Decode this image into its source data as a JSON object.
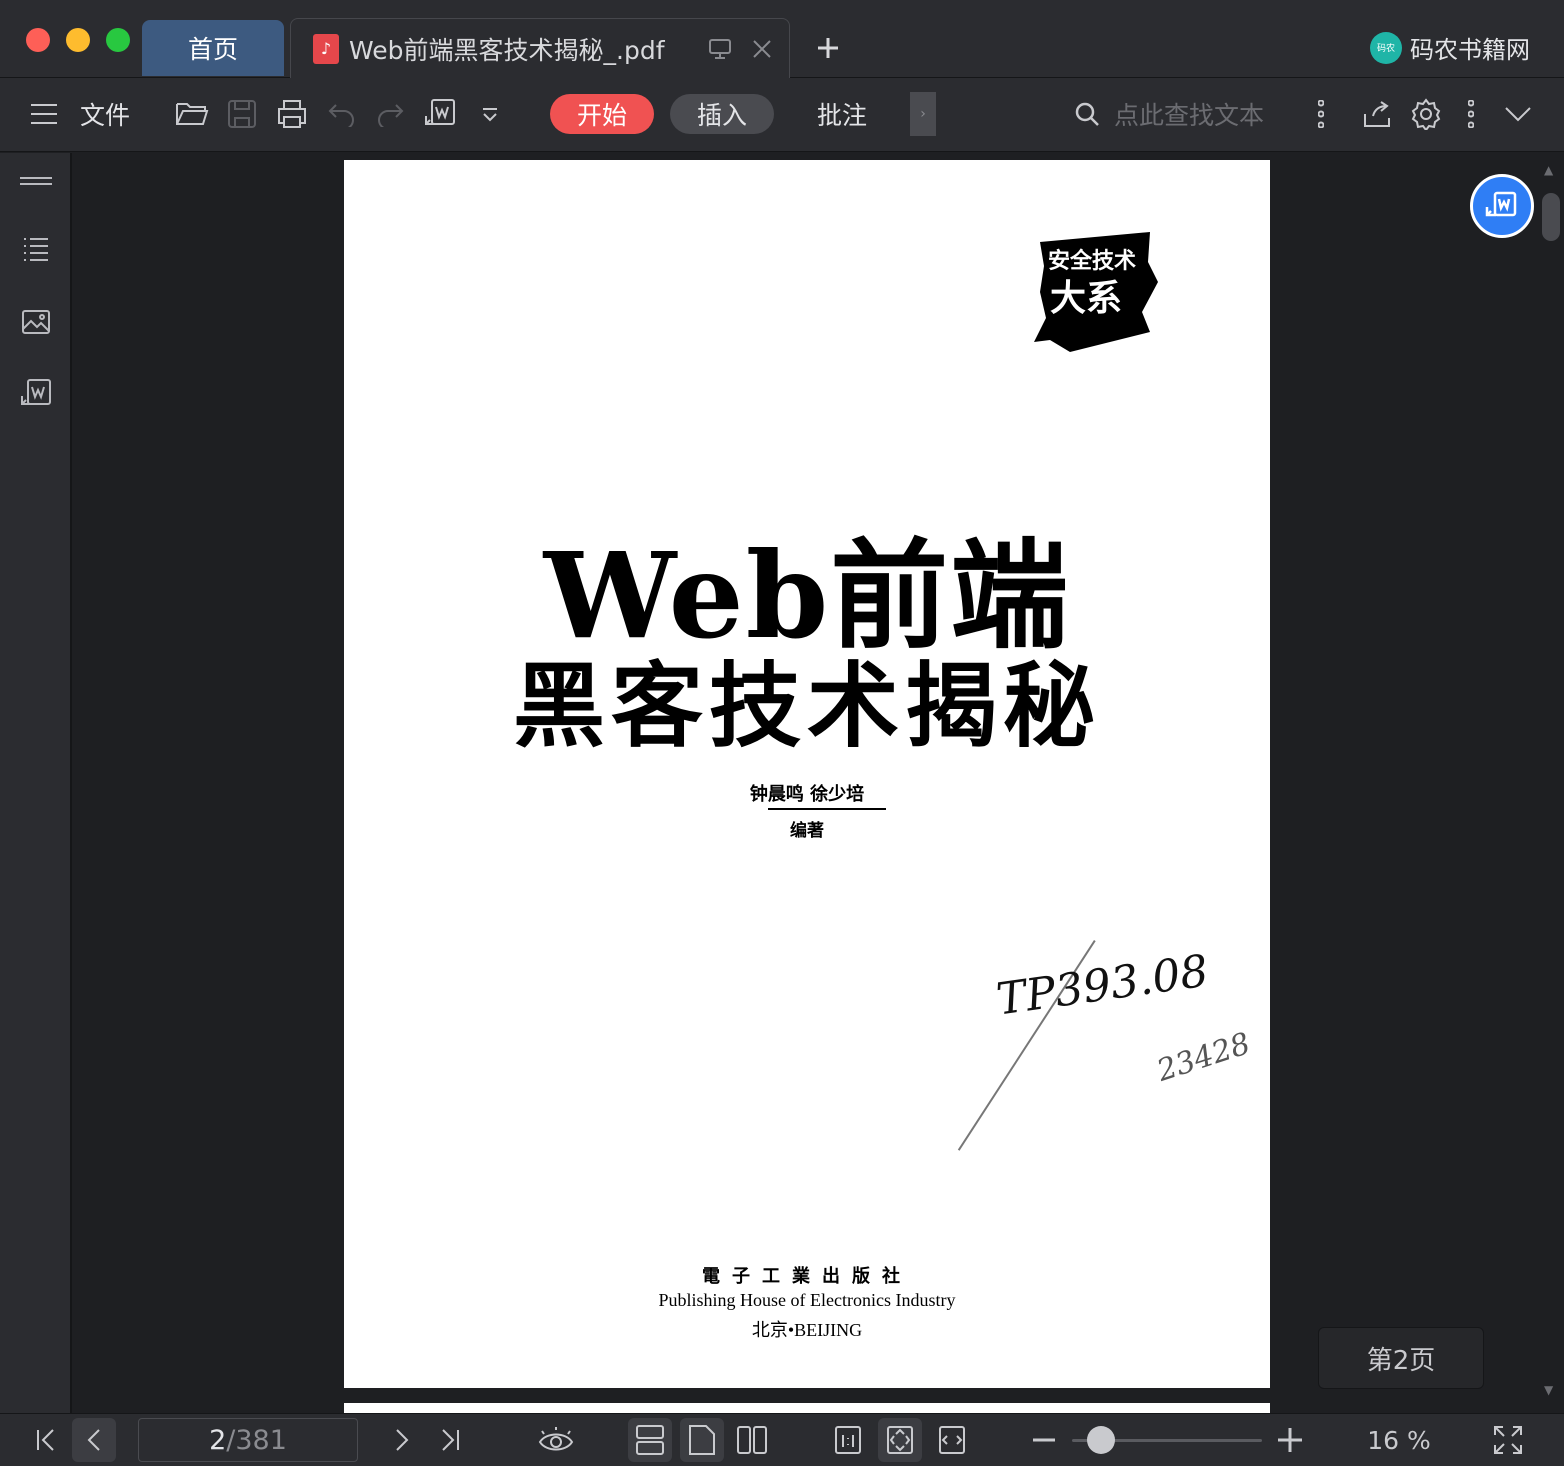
{
  "titlebar": {
    "home_tab": "首页",
    "doc_tab": "Web前端黑客技术揭秘_.pdf",
    "brand": "码农书籍网",
    "brand_logo_text": "码农"
  },
  "toolbar": {
    "file_label": "文件",
    "tabs": [
      "开始",
      "插入",
      "批注"
    ],
    "search_placeholder": "点此查找文本"
  },
  "document": {
    "badge_line1": "安全技术",
    "badge_line2": "大系",
    "title_line1": "Web前端",
    "title_line2": "黑客技术揭秘",
    "authors": "钟晨鸣  徐少培",
    "editor": "编著",
    "handwriting1": "TP393.08",
    "handwriting2": "23428",
    "publisher_cn": "電子工業出版社",
    "publisher_en": "Publishing House of Electronics Industry",
    "publisher_city": "北京•BEIJING"
  },
  "page_indicator": "第2页",
  "statusbar": {
    "current_page": "2",
    "total_pages": "/381",
    "zoom": "16 %"
  }
}
